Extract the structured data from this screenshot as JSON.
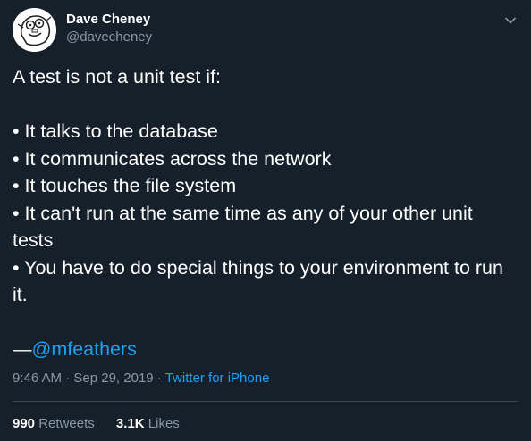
{
  "author": {
    "display_name": "Dave Cheney",
    "handle": "@davecheney"
  },
  "tweet": {
    "lines": [
      "A test is not a unit test if:",
      "",
      "• It talks to the database",
      "• It communicates across the network",
      "• It touches the file system",
      "• It can't run at the same time as any of your other unit tests",
      "• You have to do special things to your environment to run it.",
      ""
    ],
    "attribution_prefix": "—",
    "attribution_mention": "@mfeathers"
  },
  "meta": {
    "time": "9:46 AM",
    "separator1": " · ",
    "date": "Sep 29, 2019",
    "separator2": " · ",
    "source": "Twitter for iPhone"
  },
  "stats": {
    "retweets_count": "990",
    "retweets_label": "Retweets",
    "likes_count": "3.1K",
    "likes_label": "Likes"
  },
  "icons": {
    "avatar": "cartoon-avatar-icon",
    "menu": "chevron-down-icon"
  },
  "colors": {
    "background": "#15202b",
    "text": "#ffffff",
    "secondary": "#8899a6",
    "link": "#1da1f2",
    "divider": "#38444d"
  }
}
